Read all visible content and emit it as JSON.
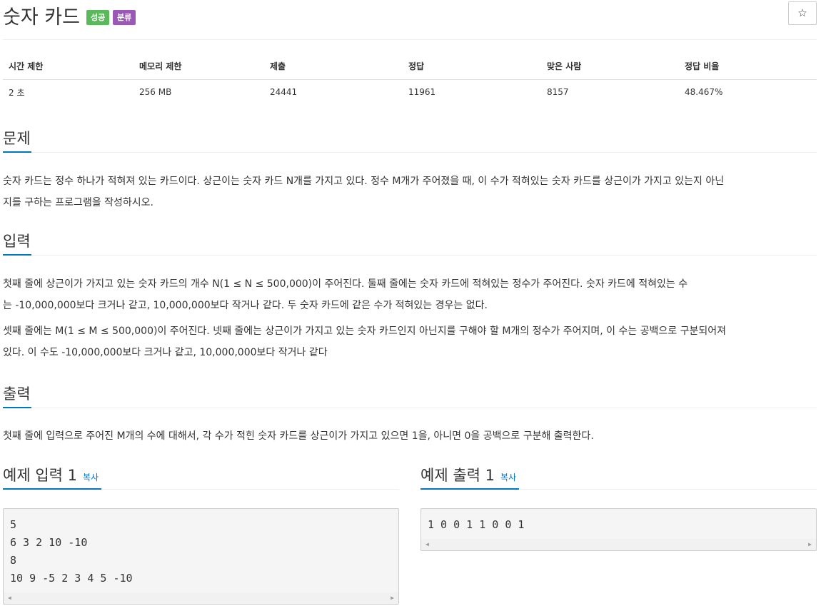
{
  "problem": {
    "title": "숫자 카드",
    "badges": [
      "성공",
      "분류"
    ],
    "star": "☆"
  },
  "info_table": {
    "headers": [
      "시간 제한",
      "메모리 제한",
      "제출",
      "정답",
      "맞은 사람",
      "정답 비율"
    ],
    "values": [
      "2 초",
      "256 MB",
      "24441",
      "11961",
      "8157",
      "48.467%"
    ]
  },
  "sections": {
    "problem": {
      "heading": "문제",
      "lines": [
        "숫자 카드는 정수 하나가 적혀져 있는 카드이다. 상근이는 숫자 카드 N개를 가지고 있다. 정수 M개가 주어졌을 때, 이 수가 적혀있는 숫자 카드를 상근이가 가지고 있는지 아닌",
        "지를 구하는 프로그램을 작성하시오."
      ]
    },
    "input": {
      "heading": "입력",
      "p1": [
        "첫째 줄에 상근이가 가지고 있는 숫자 카드의 개수 N(1 ≤ N ≤ 500,000)이 주어진다. 둘째 줄에는 숫자 카드에 적혀있는 정수가 주어진다. 숫자 카드에 적혀있는 수",
        "는 -10,000,000보다 크거나 같고, 10,000,000보다 작거나 같다. 두 숫자 카드에 같은 수가 적혀있는 경우는 없다."
      ],
      "p2": [
        "셋째 줄에는 M(1 ≤ M ≤ 500,000)이 주어진다. 넷째 줄에는 상근이가 가지고 있는 숫자 카드인지 아닌지를 구해야 할 M개의 정수가 주어지며, 이 수는 공백으로 구분되어져",
        "있다. 이 수도 -10,000,000보다 크거나 같고, 10,000,000보다 작거나 같다"
      ]
    },
    "output": {
      "heading": "출력",
      "line": "첫째 줄에 입력으로 주어진 M개의 수에 대해서, 각 수가 적힌 숫자 카드를 상근이가 가지고 있으면 1을, 아니면 0을 공백으로 구분해 출력한다."
    }
  },
  "examples": {
    "input": {
      "heading": "예제 입력 1",
      "copy": "복사",
      "lines": [
        "5",
        "6 3 2 10 -10",
        "8",
        "10 9 -5 2 3 4 5 -10"
      ]
    },
    "output": {
      "heading": "예제 출력 1",
      "copy": "복사",
      "lines": [
        "1 0 0 1 1 0 0 1"
      ]
    }
  },
  "colors": {
    "accent": "#0076c0",
    "success": "#5cb85c",
    "category": "#9b59b6"
  }
}
